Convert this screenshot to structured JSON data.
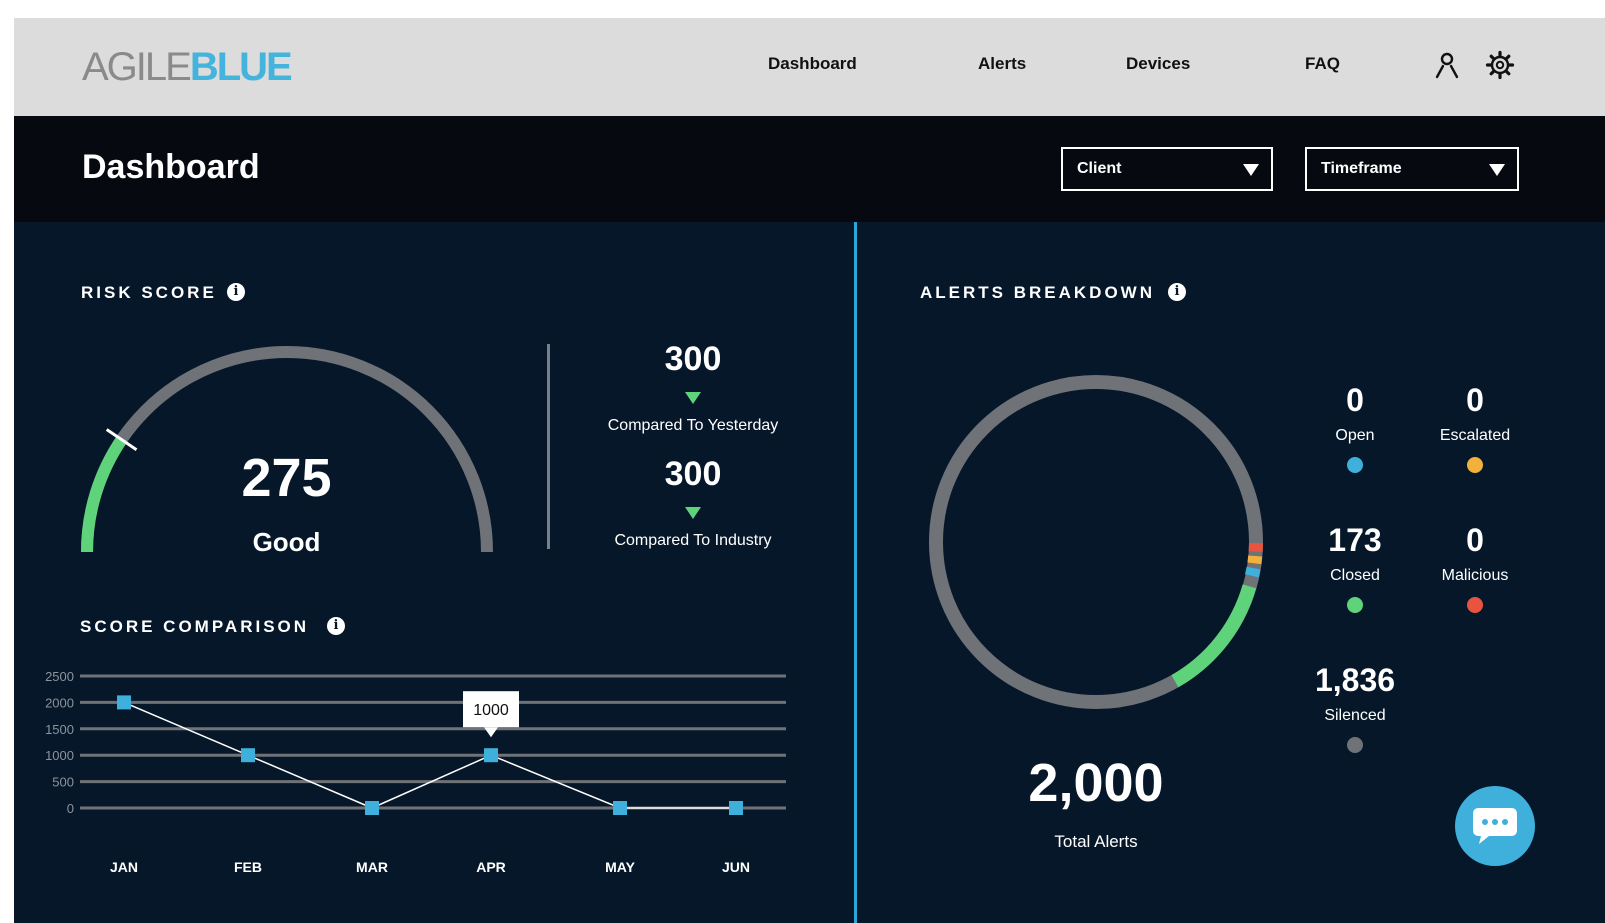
{
  "logo": {
    "part1": "AGILE",
    "part2": "BLUE"
  },
  "nav": {
    "items": [
      {
        "label": "Dashboard"
      },
      {
        "label": "Alerts"
      },
      {
        "label": "Devices"
      },
      {
        "label": "FAQ"
      }
    ],
    "icons": [
      "user-icon",
      "gear-icon"
    ]
  },
  "header": {
    "title": "Dashboard",
    "client_select": {
      "label": "Client"
    },
    "timeframe_select": {
      "label": "Timeframe"
    }
  },
  "risk_score": {
    "title": "RISK SCORE",
    "value": "275",
    "rating": "Good",
    "gauge_fraction": 0.19,
    "yesterday": {
      "value": "300",
      "label": "Compared To Yesterday"
    },
    "industry": {
      "value": "300",
      "label": "Compared To Industry"
    },
    "colors": {
      "good": "#5fd37a",
      "track": "#6f7378",
      "trend_down": "#5fd37a"
    }
  },
  "score_comparison": {
    "title": "SCORE COMPARISON",
    "tooltip": "1000",
    "point_color": "#3fb0dc"
  },
  "chart_data": {
    "type": "line",
    "categories": [
      "JAN",
      "FEB",
      "MAR",
      "APR",
      "MAY",
      "JUN"
    ],
    "values": [
      2000,
      1000,
      0,
      1000,
      0,
      0
    ],
    "y_ticks": [
      "0",
      "500",
      "1000",
      "1500",
      "2000",
      "2500"
    ],
    "ylim": [
      0,
      2500
    ],
    "grid": true
  },
  "alerts_breakdown": {
    "title": "ALERTS BREAKDOWN",
    "total_value": "2,000",
    "total_label": "Total Alerts",
    "stats": [
      {
        "value": "0",
        "label": "Open",
        "color": "#3fb0dc"
      },
      {
        "value": "0",
        "label": "Escalated",
        "color": "#f2b13a"
      },
      {
        "value": "173",
        "label": "Closed",
        "color": "#5fd37a"
      },
      {
        "value": "0",
        "label": "Malicious",
        "color": "#e8543f"
      },
      {
        "value": "1,836",
        "label": "Silenced",
        "color": "#6f7378"
      }
    ]
  },
  "chat": {
    "icon": "chat-icon"
  }
}
